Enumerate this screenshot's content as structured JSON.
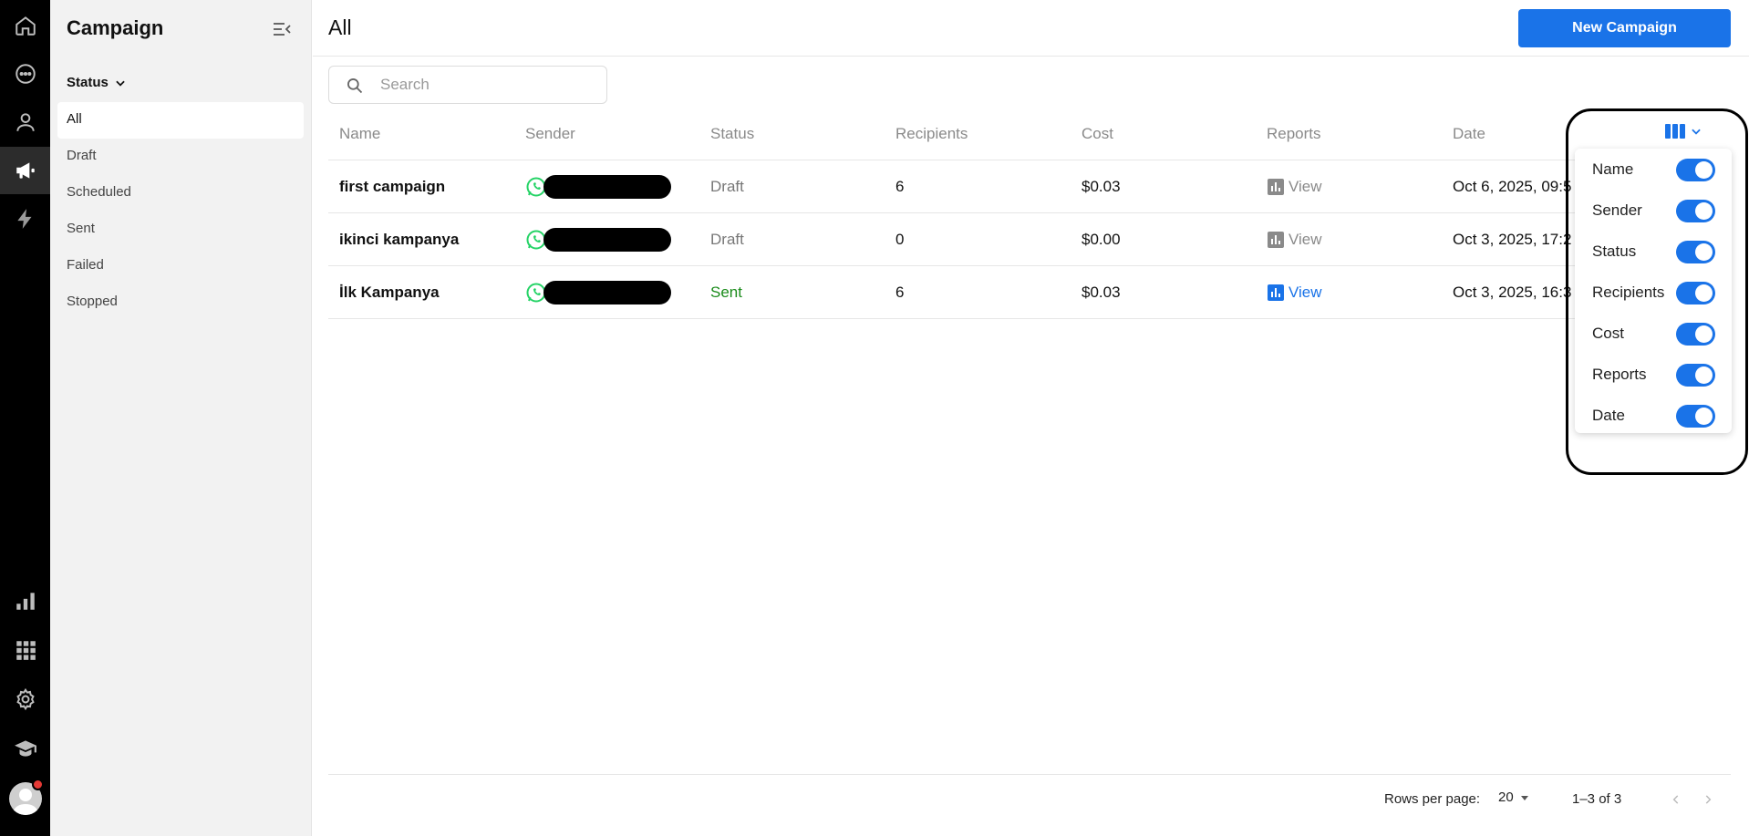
{
  "rail": {
    "items": [
      {
        "icon": "home-icon"
      },
      {
        "icon": "chat-icon"
      },
      {
        "icon": "contacts-icon"
      },
      {
        "icon": "megaphone-icon",
        "active": true
      },
      {
        "icon": "bolt-icon"
      },
      {
        "icon": "bar-chart-icon"
      },
      {
        "icon": "apps-grid-icon"
      },
      {
        "icon": "gear-icon"
      },
      {
        "icon": "graduation-cap-icon"
      }
    ]
  },
  "sidebar": {
    "title": "Campaign",
    "filter_label": "Status",
    "items": [
      {
        "label": "All",
        "active": true
      },
      {
        "label": "Draft"
      },
      {
        "label": "Scheduled"
      },
      {
        "label": "Sent"
      },
      {
        "label": "Failed"
      },
      {
        "label": "Stopped"
      }
    ]
  },
  "header": {
    "title": "All",
    "new_button": "New Campaign"
  },
  "search": {
    "placeholder": "Search",
    "value": ""
  },
  "table": {
    "columns": [
      "Name",
      "Sender",
      "Status",
      "Recipients",
      "Cost",
      "Reports",
      "Date"
    ],
    "rows": [
      {
        "name": "first campaign",
        "status": "Draft",
        "recipients": "6",
        "cost": "$0.03",
        "report": "View",
        "date": "Oct 6, 2025, 09:5"
      },
      {
        "name": "ikinci kampanya",
        "status": "Draft",
        "recipients": "0",
        "cost": "$0.00",
        "report": "View",
        "date": "Oct 3, 2025, 17:2"
      },
      {
        "name": "İlk Kampanya",
        "status": "Sent",
        "recipients": "6",
        "cost": "$0.03",
        "report": "View",
        "date": "Oct 3, 2025, 16:3"
      }
    ]
  },
  "column_menu": {
    "items": [
      {
        "label": "Name",
        "on": true
      },
      {
        "label": "Sender",
        "on": true
      },
      {
        "label": "Status",
        "on": true
      },
      {
        "label": "Recipients",
        "on": true
      },
      {
        "label": "Cost",
        "on": true
      },
      {
        "label": "Reports",
        "on": true
      },
      {
        "label": "Date",
        "on": true
      }
    ]
  },
  "footer": {
    "rows_per_page_label": "Rows per page:",
    "rows_per_page_value": "20",
    "range": "1–3 of 3"
  },
  "colors": {
    "accent": "#1a73e8",
    "sent": "#1a8b1a",
    "whatsapp": "#25d366"
  }
}
